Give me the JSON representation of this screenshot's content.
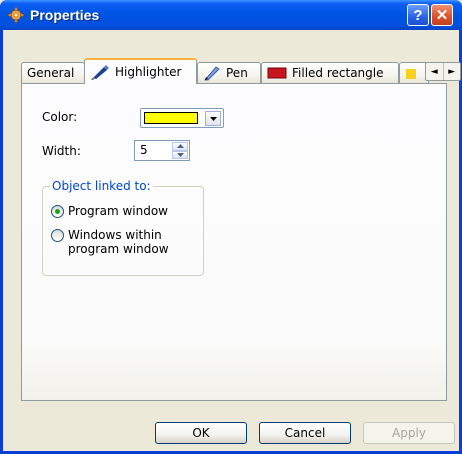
{
  "window": {
    "title": "Properties",
    "help_label": "?",
    "close_label": "✕"
  },
  "tabs": [
    {
      "label": "General",
      "icon": "none",
      "active": false
    },
    {
      "label": "Highlighter",
      "icon": "highlighter-pen-icon",
      "active": true
    },
    {
      "label": "Pen",
      "icon": "pen-icon",
      "active": false
    },
    {
      "label": "Filled rectangle",
      "icon": "filled-rectangle-icon",
      "active": false
    }
  ],
  "tab_scroll": {
    "left": "◄",
    "right": "►"
  },
  "form": {
    "color_label": "Color:",
    "color_value": "#ffff00",
    "width_label": "Width:",
    "width_value": "5",
    "group_title": "Object linked to:",
    "options": [
      {
        "label": "Program window",
        "selected": true
      },
      {
        "label": "Windows within program window",
        "selected": false
      }
    ]
  },
  "buttons": {
    "ok": "OK",
    "cancel": "Cancel",
    "apply": "Apply",
    "apply_enabled": false
  },
  "colors": {
    "title_bar": "#0054e3",
    "tab_accent": "#f9b33a",
    "group_title": "#0046d5",
    "radio_dot": "#21a121"
  }
}
